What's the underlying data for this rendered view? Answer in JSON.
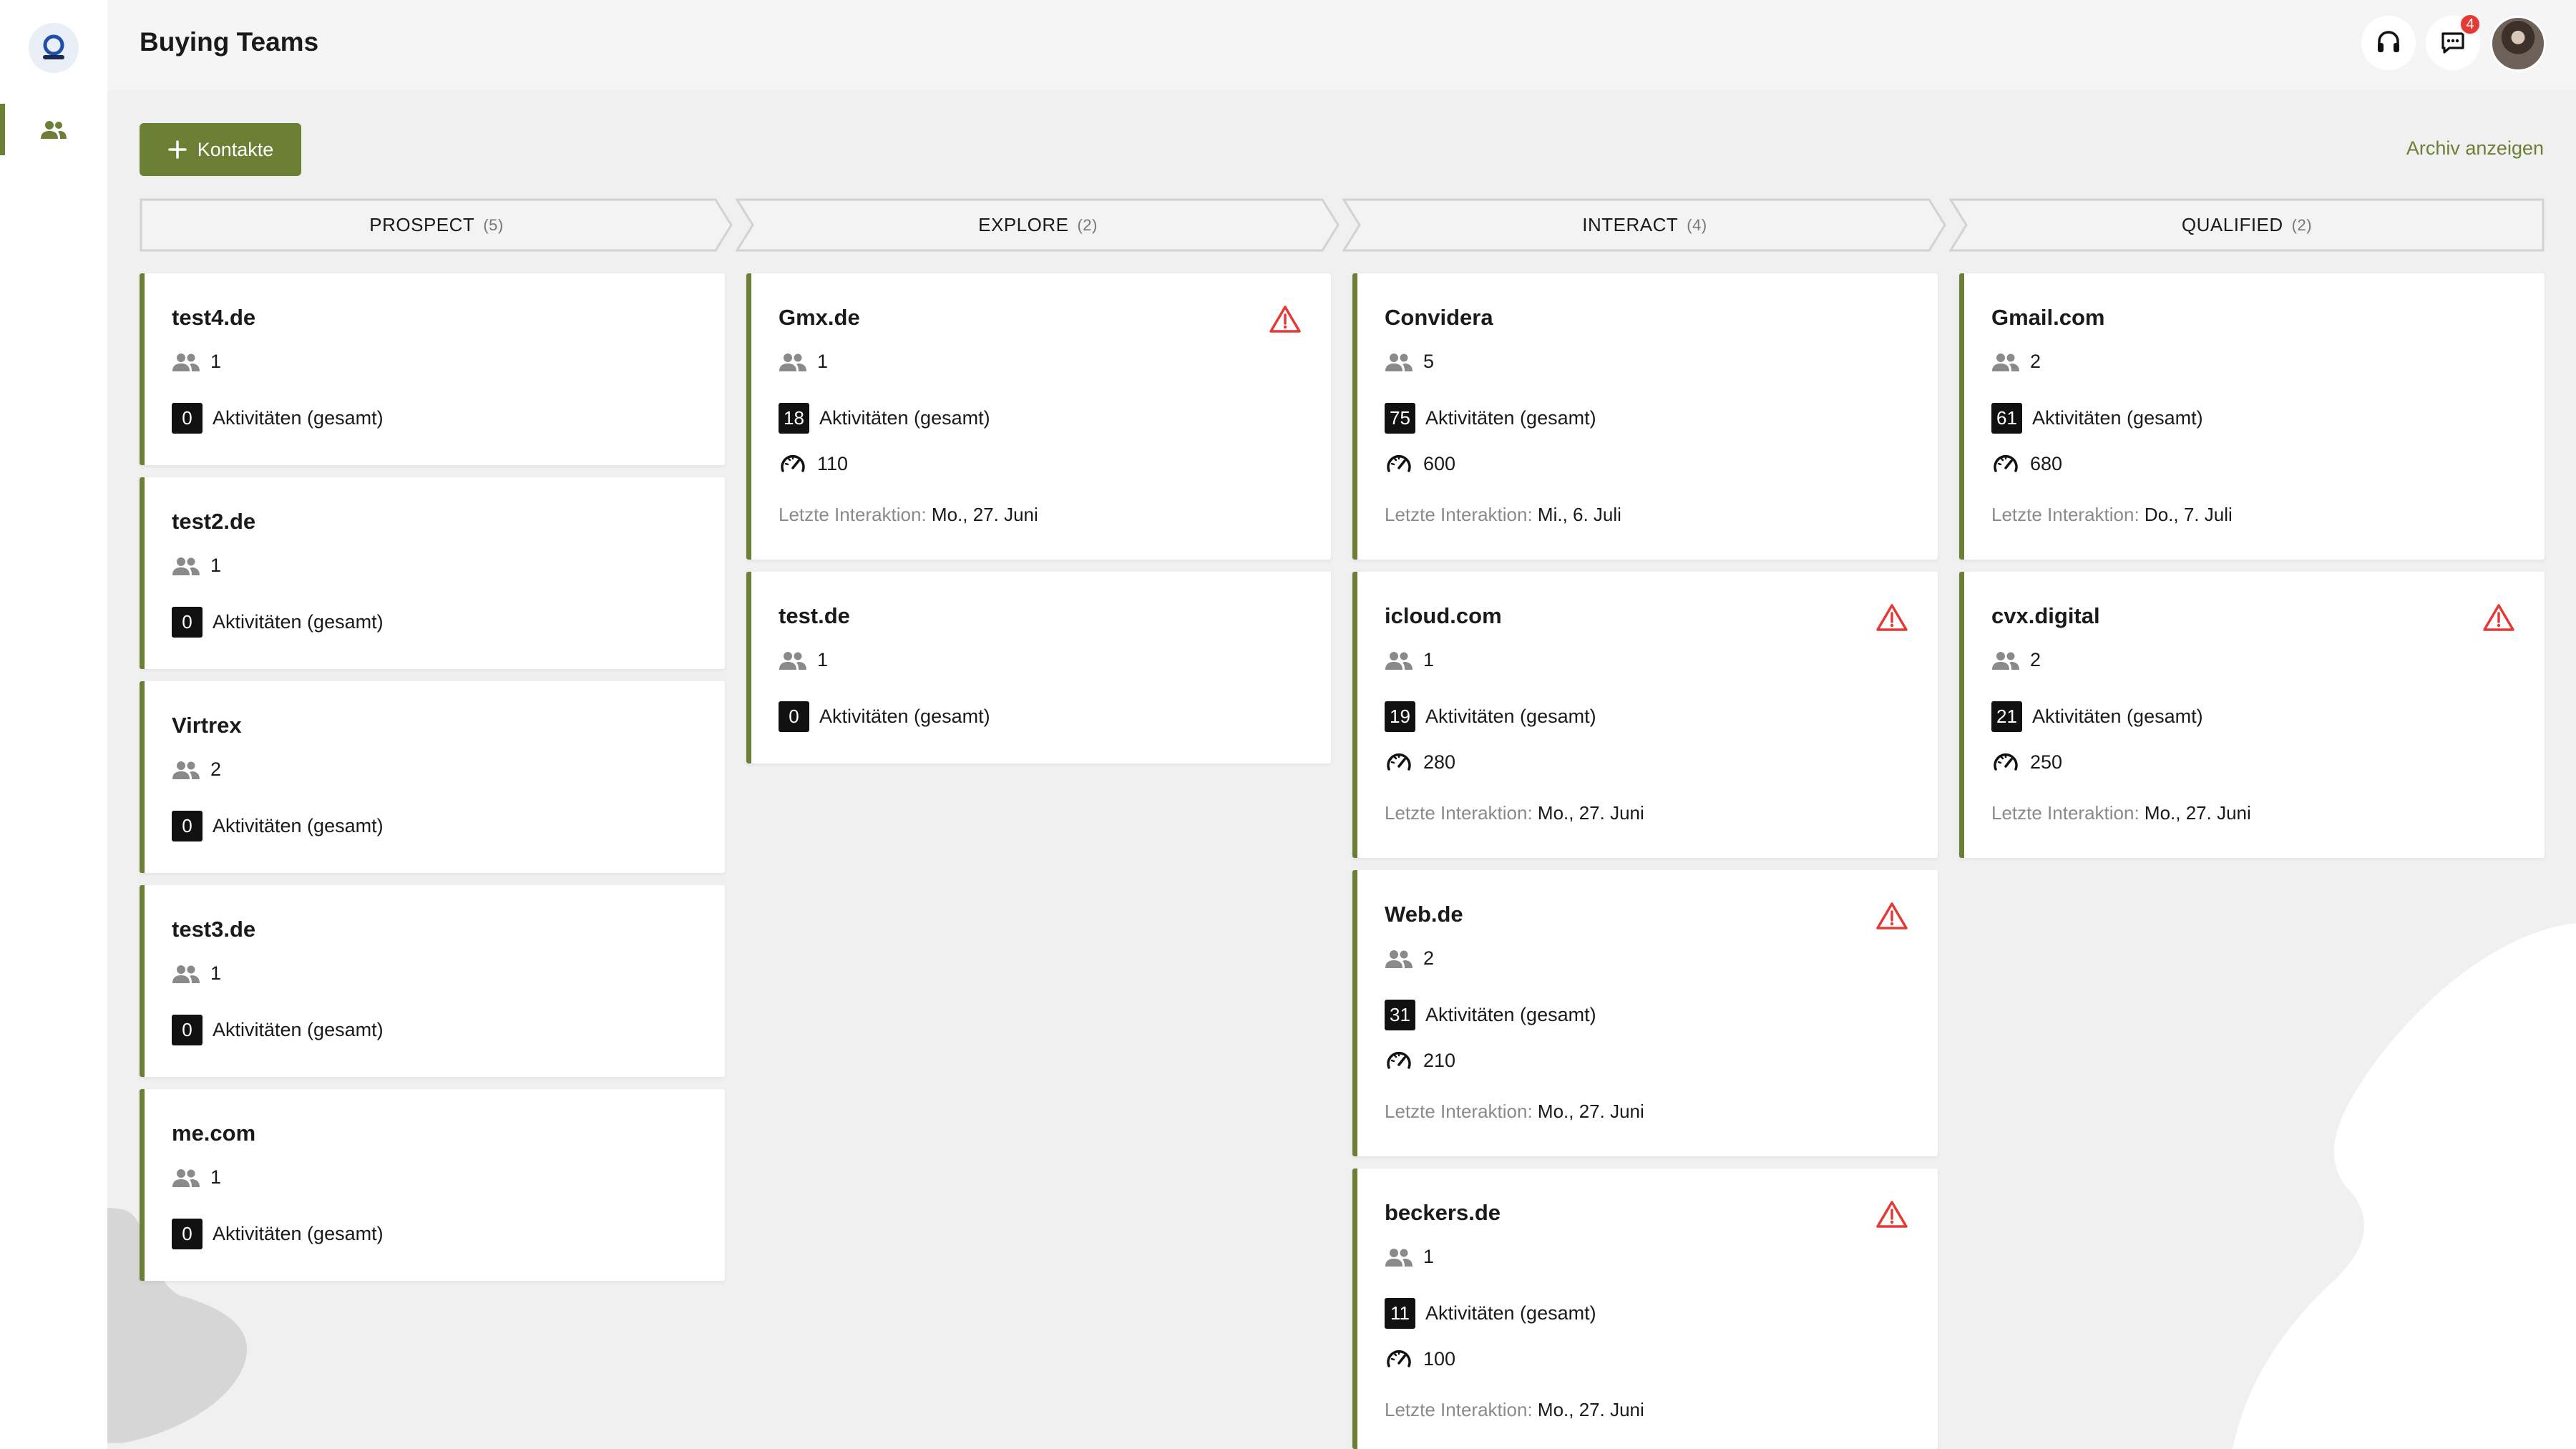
{
  "header": {
    "title": "Buying Teams",
    "notification_count": "4"
  },
  "toolbar": {
    "add_label": "Kontakte",
    "archive_label": "Archiv anzeigen"
  },
  "labels": {
    "activities": "Aktivitäten (gesamt)",
    "last_interaction": "Letzte Interaktion:"
  },
  "colors": {
    "accent": "#6b7f35",
    "warning": "#e53935"
  },
  "icons": [
    "logo-icon",
    "people-icon",
    "headset-icon",
    "chat-icon",
    "plus-icon",
    "warning-icon",
    "speedometer-icon"
  ],
  "stages": [
    {
      "name": "PROSPECT",
      "count": "(5)",
      "cards": [
        {
          "title": "test4.de",
          "members": "1",
          "activities": "0"
        },
        {
          "title": "test2.de",
          "members": "1",
          "activities": "0"
        },
        {
          "title": "Virtrex",
          "members": "2",
          "activities": "0"
        },
        {
          "title": "test3.de",
          "members": "1",
          "activities": "0"
        },
        {
          "title": "me.com",
          "members": "1",
          "activities": "0"
        }
      ]
    },
    {
      "name": "EXPLORE",
      "count": "(2)",
      "cards": [
        {
          "title": "Gmx.de",
          "members": "1",
          "activities": "18",
          "score": "110",
          "last_date": "Mo., 27. Juni",
          "warning": true
        },
        {
          "title": "test.de",
          "members": "1",
          "activities": "0"
        }
      ]
    },
    {
      "name": "INTERACT",
      "count": "(4)",
      "cards": [
        {
          "title": "Convidera",
          "members": "5",
          "activities": "75",
          "score": "600",
          "last_date": "Mi., 6. Juli"
        },
        {
          "title": "icloud.com",
          "members": "1",
          "activities": "19",
          "score": "280",
          "last_date": "Mo., 27. Juni",
          "warning": true
        },
        {
          "title": "Web.de",
          "members": "2",
          "activities": "31",
          "score": "210",
          "last_date": "Mo., 27. Juni",
          "warning": true
        },
        {
          "title": "beckers.de",
          "members": "1",
          "activities": "11",
          "score": "100",
          "last_date": "Mo., 27. Juni",
          "warning": true
        }
      ]
    },
    {
      "name": "QUALIFIED",
      "count": "(2)",
      "cards": [
        {
          "title": "Gmail.com",
          "members": "2",
          "activities": "61",
          "score": "680",
          "last_date": "Do., 7. Juli"
        },
        {
          "title": "cvx.digital",
          "members": "2",
          "activities": "21",
          "score": "250",
          "last_date": "Mo., 27. Juni",
          "warning": true
        }
      ]
    }
  ]
}
